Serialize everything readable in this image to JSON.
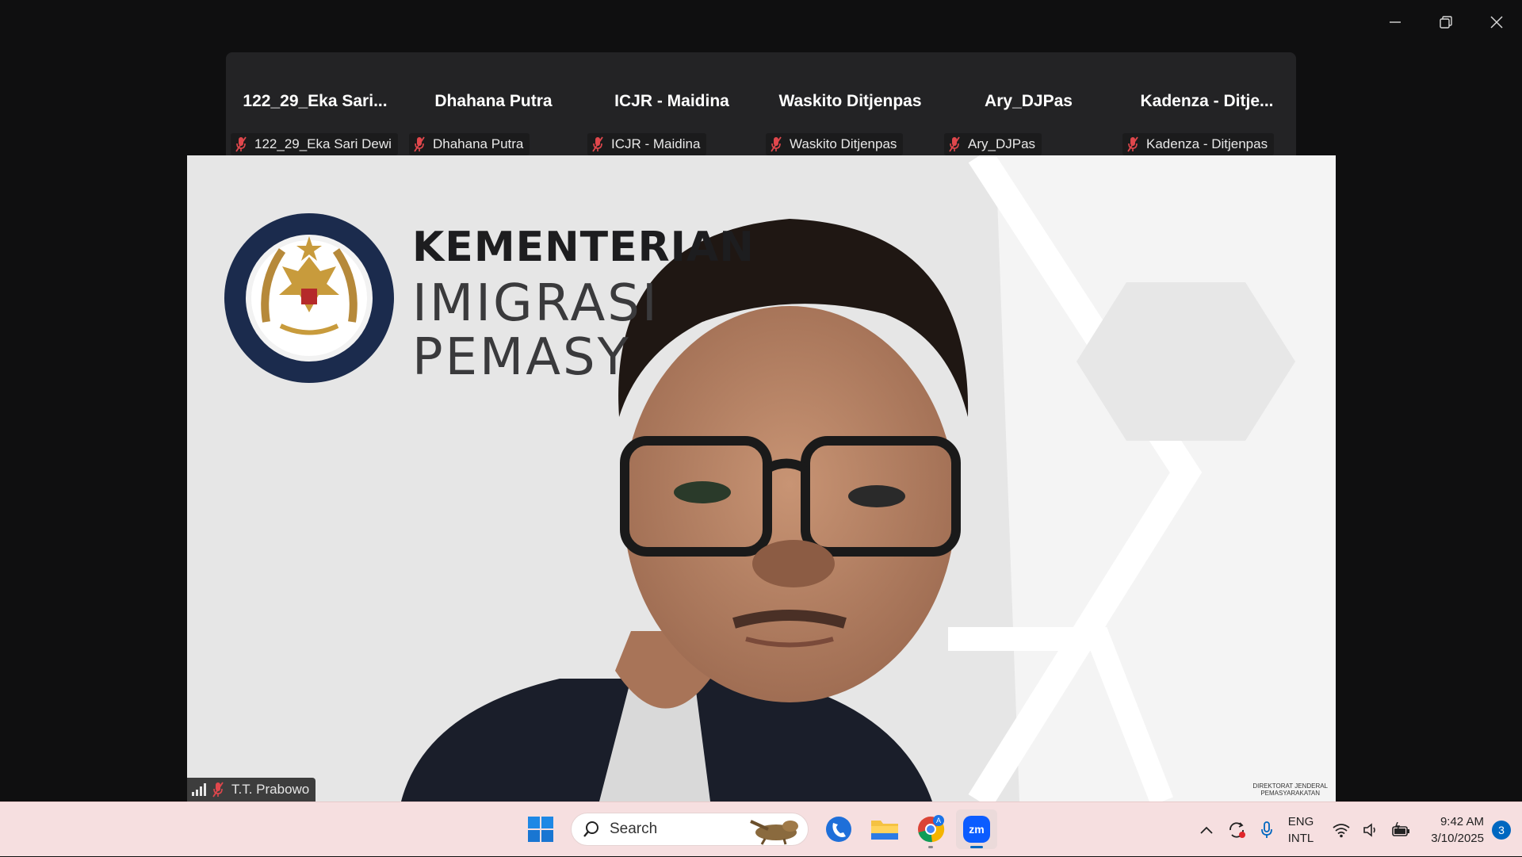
{
  "participants": [
    {
      "display_name": "122_29_Eka Sari...",
      "tag": "122_29_Eka Sari Dewi"
    },
    {
      "display_name": "Dhahana Putra",
      "tag": "Dhahana Putra"
    },
    {
      "display_name": "ICJR - Maidina",
      "tag": "ICJR - Maidina"
    },
    {
      "display_name": "Waskito Ditjenpas",
      "tag": "Waskito Ditjenpas"
    },
    {
      "display_name": "Ary_DJPas",
      "tag": "Ary_DJPas"
    },
    {
      "display_name": "Kadenza - Ditje...",
      "tag": "Kadenza - Ditjenpas"
    }
  ],
  "main_video": {
    "speaker_name": "T.T. Prabowo",
    "background": {
      "line1": "KEMENTERIAN",
      "line2": "IMIGRASI",
      "line3": "PEMASY",
      "seal_top_text": "KEMENTERIAN IMIGRASI DAN PEMASYARAKATAN",
      "seal_bottom_text": "REPUBLIK INDONESIA",
      "footer_line1": "DIREKTORAT JENDERAL",
      "footer_line2": "PEMASYARAKATAN"
    }
  },
  "taskbar": {
    "search_placeholder": "Search",
    "lang_line1": "ENG",
    "lang_line2": "INTL",
    "time": "9:42 AM",
    "date": "3/10/2025",
    "notification_count": "3",
    "chrome_badge": "A"
  },
  "colors": {
    "accent": "#0067c0",
    "muted_mic": "#e0474c",
    "zoom_blue": "#0b5cff",
    "taskbar_bg": "#f6dfe0"
  },
  "icons": {
    "window": [
      "minimize-icon",
      "restore-icon",
      "close-icon"
    ],
    "taskbar": [
      "windows-start-icon",
      "search-icon",
      "phone-link-icon",
      "file-explorer-icon",
      "chrome-icon",
      "zoom-icon"
    ],
    "tray": [
      "chevron-up-icon",
      "sync-icon",
      "microphone-icon",
      "wifi-icon",
      "speaker-icon",
      "battery-icon"
    ]
  }
}
